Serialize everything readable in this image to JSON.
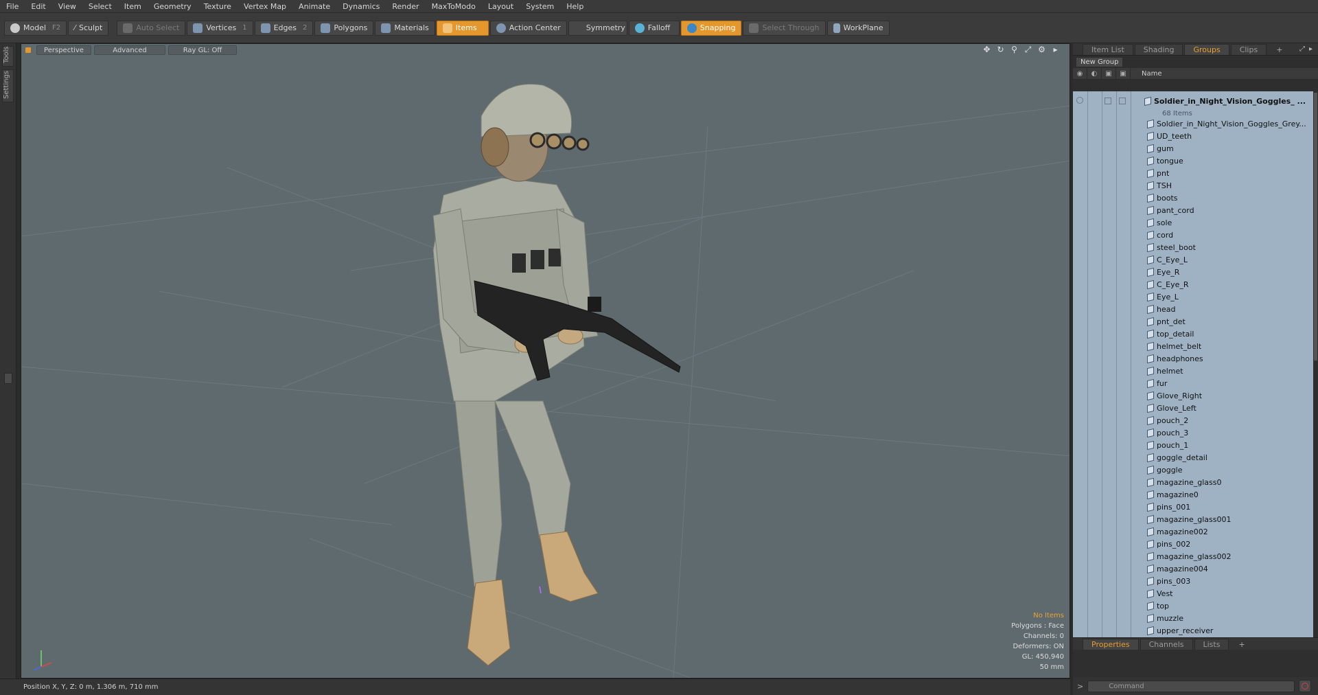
{
  "menu": [
    "File",
    "Edit",
    "View",
    "Select",
    "Item",
    "Geometry",
    "Texture",
    "Vertex Map",
    "Animate",
    "Dynamics",
    "Render",
    "MaxToModo",
    "Layout",
    "System",
    "Help"
  ],
  "toolbar": {
    "model": "Model",
    "model_shortcut": "F2",
    "sculpt": "Sculpt",
    "auto_select": "Auto Select",
    "vertices": "Vertices",
    "vertices_shortcut": "1",
    "edges": "Edges",
    "edges_shortcut": "2",
    "polygons": "Polygons",
    "materials": "Materials",
    "items": "Items",
    "action_center": "Action Center",
    "symmetry": "Symmetry",
    "falloff": "Falloff",
    "snapping": "Snapping",
    "select_through": "Select Through",
    "workplane": "WorkPlane",
    "accent_color": "#e3972c"
  },
  "left_tabs": [
    "Tools",
    "Settings"
  ],
  "viewport": {
    "perspective": "Perspective",
    "advanced": "Advanced",
    "raygl": "Ray GL: Off",
    "info": {
      "items": "No Items",
      "polygons": "Polygons : Face",
      "channels": "Channels: 0",
      "deformers": "Deformers: ON",
      "gl": "GL: 450,940",
      "focal": "50 mm"
    },
    "background_color": "#5f6a6f"
  },
  "status": "Position X, Y, Z:   0 m, 1.306 m, 710 mm",
  "right_panel": {
    "tabs": [
      "Item List",
      "Shading",
      "Groups",
      "Clips"
    ],
    "active_tab": "Groups",
    "new_group": "New Group",
    "column_name": "Name",
    "group_name": "Soldier_in_Night_Vision_Goggles_ ...",
    "group_count": "68 Items",
    "mesh_item": "Soldier_in_Night_Vision_Goggles_Grey...",
    "items": [
      "UD_teeth",
      "gum",
      "tongue",
      "pnt",
      "TSH",
      "boots",
      "pant_cord",
      "sole",
      "cord",
      "steel_boot",
      "C_Eye_L",
      "Eye_R",
      "C_Eye_R",
      "Eye_L",
      "head",
      "pnt_det",
      "top_detail",
      "helmet_belt",
      "headphones",
      "helmet",
      "fur",
      "Glove_Right",
      "Glove_Left",
      "pouch_2",
      "pouch_3",
      "pouch_1",
      "goggle_detail",
      "goggle",
      "magazine_glass0",
      "magazine0",
      "pins_001",
      "magazine_glass001",
      "magazine002",
      "pins_002",
      "magazine_glass002",
      "magazine004",
      "pins_003",
      "Vest",
      "top",
      "muzzle",
      "upper_receiver"
    ],
    "list_color": "#9fb2c3",
    "bottom_tabs": [
      "Properties",
      "Channels",
      "Lists"
    ],
    "bottom_active": "Properties",
    "command_placeholder": "Command"
  }
}
